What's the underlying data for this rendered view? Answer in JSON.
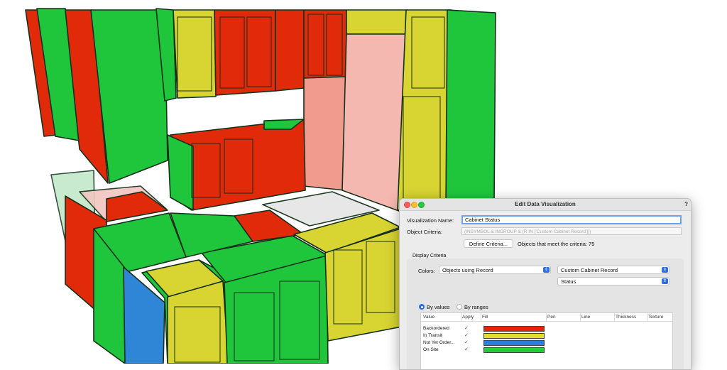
{
  "dialog": {
    "title": "Edit Data Visualization",
    "help_label": "?",
    "name_label": "Visualization Name:",
    "name_value": "Cabinet Status",
    "criteria_label": "Object Criteria:",
    "criteria_value": "(INSYMBOL & INGROUP & (R IN ['Custom Cabinet Record']))",
    "define_button": "Define Criteria...",
    "match_text": "Objects that meet the criteria: 75",
    "display_group_label": "Display Criteria",
    "colors_label": "Colors:",
    "colors_select": "Objects using Record",
    "record_select": "Custom Cabinet Record",
    "field_select": "Status",
    "by_values_label": "By values",
    "by_ranges_label": "By ranges",
    "by_values_selected": true,
    "table": {
      "headers": [
        "Value",
        "Apply",
        "Fill",
        "Pen",
        "Line",
        "Thickness",
        "Texture"
      ],
      "rows": [
        {
          "value": "Backordered",
          "apply": "✓",
          "fill": "#e8200c"
        },
        {
          "value": "In Transit",
          "apply": "✓",
          "fill": "#e2dc2a"
        },
        {
          "value": "Not Yet Order...",
          "apply": "✓",
          "fill": "#2a80e0"
        },
        {
          "value": "On Site",
          "apply": "✓",
          "fill": "#22cc3c"
        }
      ]
    }
  },
  "colors": {
    "red": "#e02a0a",
    "green": "#1fc63c",
    "yellow": "#d8d432",
    "blue": "#2f86d6",
    "outline": "#0a3a10"
  }
}
